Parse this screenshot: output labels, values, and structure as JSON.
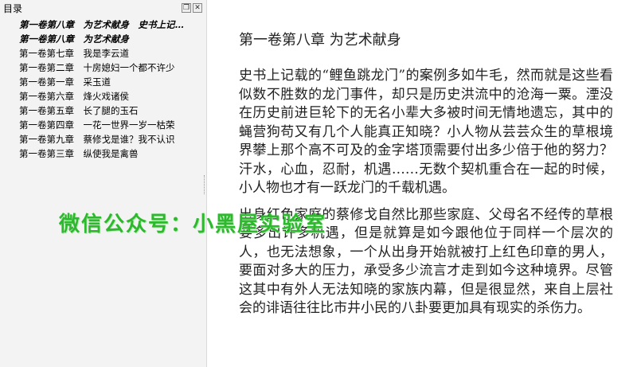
{
  "toc": {
    "title": "目录",
    "controls": {
      "restore": "❐",
      "close": "✕"
    },
    "items": [
      {
        "label": "第一卷第八章　为艺术献身　史书上记…",
        "current": true
      },
      {
        "label": "第一卷第八章　为艺术献身",
        "current": true
      },
      {
        "label": "第一卷第七章　我是李云道",
        "current": false
      },
      {
        "label": "第一卷第二章　十房媳妇一个都不许少",
        "current": false
      },
      {
        "label": "第一卷第一章　采玉道",
        "current": false
      },
      {
        "label": "第一卷第六章　烽火戏诸侯",
        "current": false
      },
      {
        "label": "第一卷第五章　长了腿的玉石",
        "current": false
      },
      {
        "label": "第一卷第四章　一花一世界一岁一枯荣",
        "current": false
      },
      {
        "label": "第一卷第九章　蔡修戈是谁？我不认识",
        "current": false
      },
      {
        "label": "第一卷第三章　纵使我是禽兽",
        "current": false
      }
    ]
  },
  "content": {
    "title": "第一卷第八章 为艺术献身",
    "paragraphs": [
      "史书上记载的“鲤鱼跳龙门”的案例多如牛毛，然而就是这些看似数不胜数的龙门事件，却只是历史洪流中的沧海一粟。湮没在历史前进巨轮下的无名小辈大多被时间无情地遗忘，其中的蝇营狗苟又有几个人能真正知晓？小人物从芸芸众生的草根境界攀上那个高不可及的金字塔顶需要付出多少倍于他的努力？汗水，心血，忍耐，机遇……无数个契机重合在一起的时候，小人物也才有一跃龙门的千载机遇。",
      "出身红色家庭的蔡修戈自然比那些家庭、父母名不经传的草根要多出许多机遇，但是就算是如今跟他位于同样一个层次的人，也无法想象，一个从出身开始就被打上红色印章的男人，要面对多大的压力，承受多少流言才走到如今这种境界。尽管这其中有外人无法知晓的家族内幕，但是很显然，来自上层社会的诽语往往比市井小民的八卦要更加具有现实的杀伤力。"
    ]
  },
  "watermark": {
    "text": "微信公众号：小黑屋实验室"
  }
}
